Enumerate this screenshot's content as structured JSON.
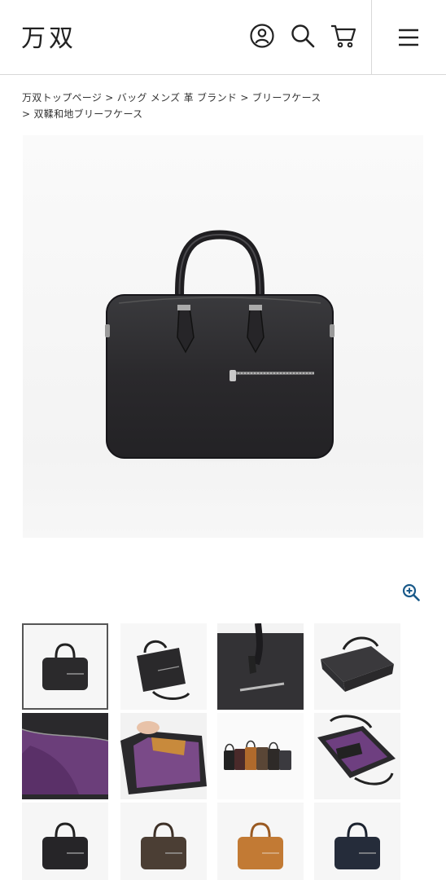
{
  "header": {
    "logo": "万双",
    "icons": [
      "user-icon",
      "search-icon",
      "cart-icon",
      "menu-icon"
    ]
  },
  "breadcrumb": {
    "items": [
      "万双トップページ",
      "バッグ メンズ 革 ブランド",
      "ブリーフケース",
      "双鞣和地ブリーフケース"
    ],
    "separator": ">"
  },
  "product": {
    "main_image": "black-leather-briefcase",
    "zoom_icon": "zoom-in-icon"
  },
  "thumbnails": {
    "selected_index": 0,
    "items": [
      "black-briefcase-front",
      "black-briefcase-with-strap",
      "briefcase-pocket-closeup",
      "briefcase-top-view",
      "purple-lining-interior",
      "hand-opening-bag",
      "color-lineup",
      "purple-interior-open",
      "black-briefcase",
      "dark-brown-briefcase",
      "tan-briefcase",
      "navy-briefcase"
    ]
  },
  "colors": {
    "accent": "#1a5a8a",
    "divider": "#d8d8d8",
    "leather_black": "#2b2a2c"
  }
}
